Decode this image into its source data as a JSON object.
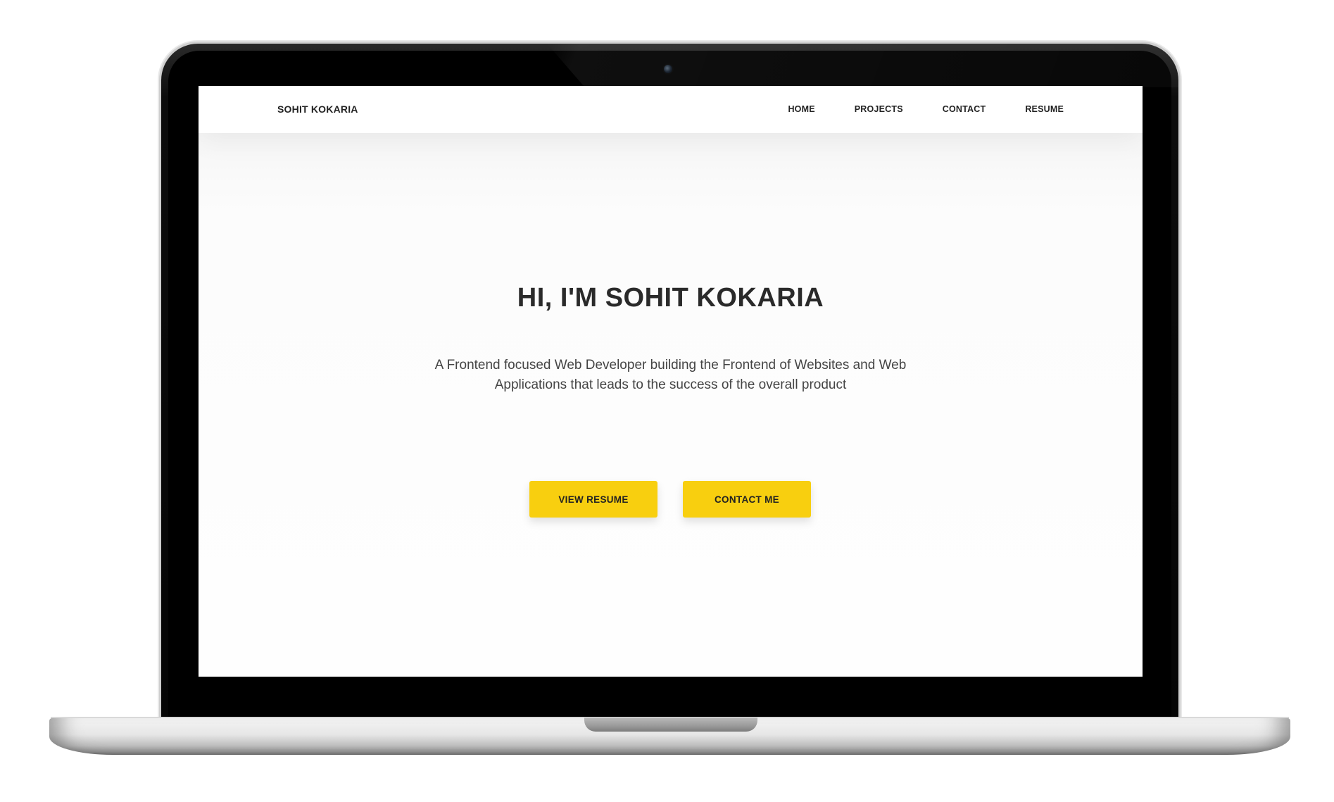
{
  "site": {
    "brand": "SOHIT KOKARIA",
    "nav": {
      "home": "HOME",
      "projects": "PROJECTS",
      "contact": "CONTACT",
      "resume": "RESUME"
    }
  },
  "hero": {
    "title": "HI, I'M SOHIT KOKARIA",
    "subtitle": "A Frontend focused Web Developer building the Frontend of Websites and Web Applications that leads to the success of the overall product",
    "primary_button": "VIEW RESUME",
    "secondary_button": "CONTACT ME"
  },
  "colors": {
    "accent": "#f8cf0f",
    "text": "#2a2a2a",
    "laptop_bezel": "#050505"
  }
}
